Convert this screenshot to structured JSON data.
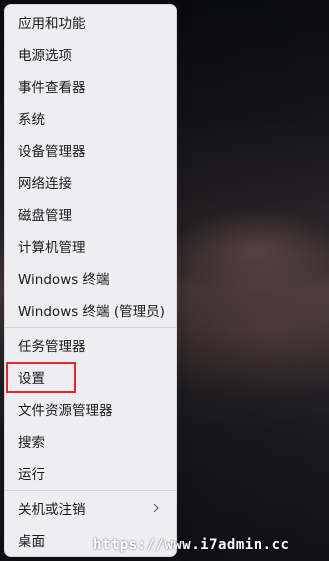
{
  "menu": {
    "items": [
      {
        "label": "应用和功能"
      },
      {
        "label": "电源选项"
      },
      {
        "label": "事件查看器"
      },
      {
        "label": "系统"
      },
      {
        "label": "设备管理器"
      },
      {
        "label": "网络连接"
      },
      {
        "label": "磁盘管理"
      },
      {
        "label": "计算机管理"
      },
      {
        "label": "Windows 终端"
      },
      {
        "label": "Windows 终端 (管理员)"
      },
      {
        "label": "任务管理器"
      },
      {
        "label": "设置"
      },
      {
        "label": "文件资源管理器"
      },
      {
        "label": "搜索"
      },
      {
        "label": "运行"
      },
      {
        "label": "关机或注销"
      },
      {
        "label": "桌面"
      }
    ],
    "submenu_icon": "chevron-right-icon",
    "highlighted_item": "设置",
    "highlight_color": "#e02a2a"
  },
  "watermark": {
    "text": "https://www.i7admin.cc"
  }
}
